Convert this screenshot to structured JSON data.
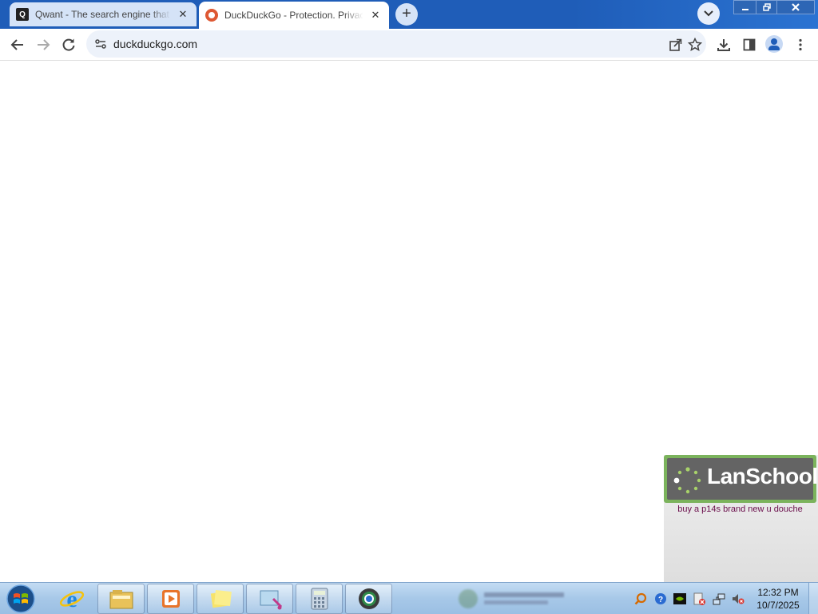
{
  "browser": {
    "tabs": [
      {
        "title": "Qwant - The search engine that",
        "favicon": "qwant-favicon",
        "favicon_letter": "Q",
        "active": false
      },
      {
        "title": "DuckDuckGo - Protection. Privacy",
        "favicon": "duckduckgo-favicon",
        "active": true
      }
    ],
    "tab_close_glyph": "✕",
    "new_tab_glyph": "+",
    "tab_search_glyph": "⌄",
    "window_controls": {
      "minimize": "—",
      "maximize": "❐",
      "close": "✕"
    },
    "address_bar": {
      "url": "duckduckgo.com"
    },
    "toolbar_glyphs": {
      "back": "←",
      "forward": "→",
      "reload": "↻",
      "menu": "⋮",
      "bookmark": "☆",
      "share": "⇱",
      "download": "⤓",
      "side_panel": "▯"
    }
  },
  "lanschool": {
    "brand": "LanSchool",
    "message": "buy a p14s brand new u douche",
    "colors": {
      "banner_border": "#7bb35c",
      "banner_bg": "#646464",
      "message_text": "#6a0d4b"
    }
  },
  "taskbar": {
    "pinned_apps": [
      "internet-explorer-icon",
      "file-explorer-icon",
      "media-player-icon",
      "sticky-notes-icon",
      "snipping-tool-icon",
      "calculator-icon",
      "chrome-icon"
    ],
    "clock": {
      "time": "12:32 PM",
      "date": "10/7/2025"
    }
  }
}
